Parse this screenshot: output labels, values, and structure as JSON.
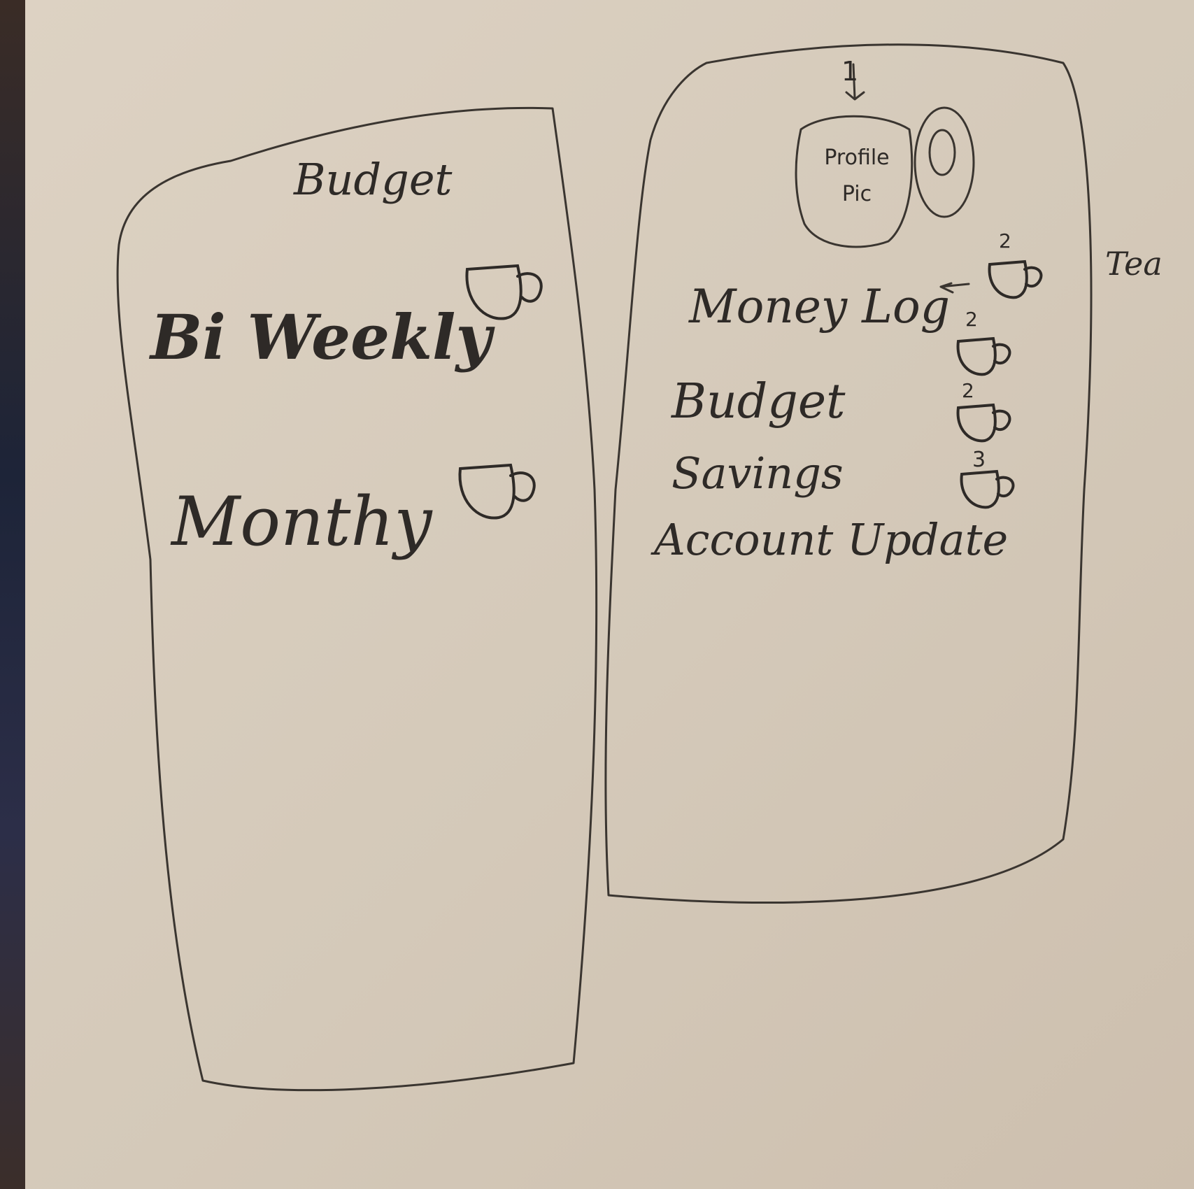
{
  "left_screen": {
    "title": "Budget",
    "items": [
      {
        "label": "Bi Weekly",
        "icon": "mug-icon"
      },
      {
        "label": "Monthy",
        "icon": "mug-icon"
      }
    ]
  },
  "right_screen": {
    "profile_pic_label": "Profile Pic",
    "arrow_marker": "1",
    "menu": [
      {
        "label": "Money Log",
        "marker": "2",
        "icon": "mug-icon"
      },
      {
        "label": "Budget",
        "marker": "2",
        "icon": "mug-icon"
      },
      {
        "label": "Savings",
        "marker": "2",
        "icon": "mug-icon"
      },
      {
        "label": "Account Update",
        "marker": "3",
        "icon": "mug-icon"
      }
    ]
  },
  "margin_note": "Tea",
  "colors": {
    "ink": "#2e2a27",
    "paper": "#d8cdbd"
  }
}
